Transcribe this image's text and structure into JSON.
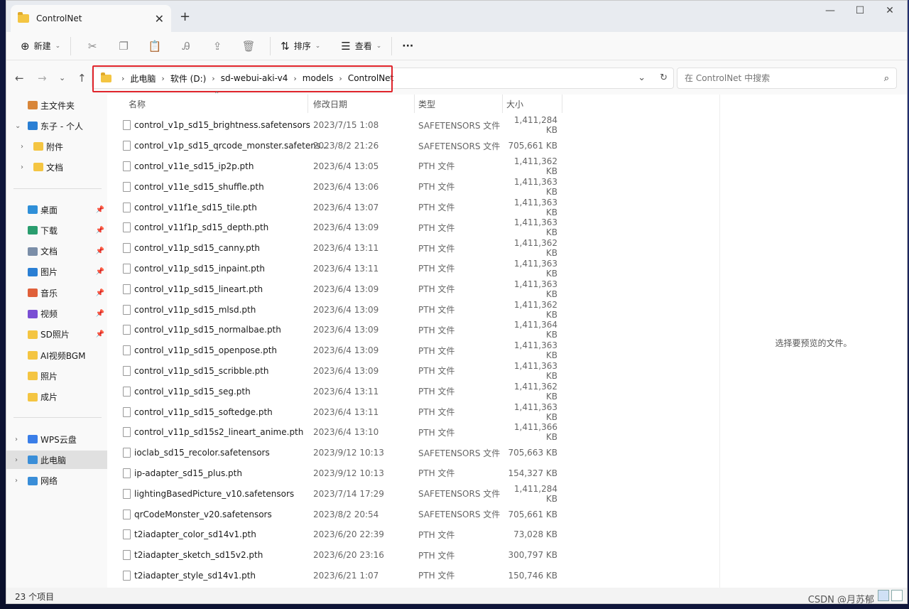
{
  "window": {
    "tab_title": "ControlNet",
    "tab_close": "✕",
    "new_tab": "+",
    "minimize": "—",
    "maximize": "☐",
    "close": "✕"
  },
  "toolbar": {
    "new_label": "新建",
    "sort_label": "排序",
    "view_label": "查看",
    "more_label": "···"
  },
  "address": {
    "breadcrumb": [
      "此电脑",
      "软件 (D:)",
      "sd-webui-aki-v4",
      "models",
      "ControlNet"
    ],
    "search_placeholder": "在 ControlNet 中搜索"
  },
  "sidebar": {
    "quick": [
      {
        "label": "主文件夹",
        "icon": "home-icon"
      },
      {
        "label": "东子 - 个人",
        "icon": "cloud-icon"
      },
      {
        "label": "附件",
        "icon": "folder-icon"
      },
      {
        "label": "文档",
        "icon": "folder-icon"
      }
    ],
    "pinned": [
      {
        "label": "桌面",
        "icon": "desktop-icon",
        "color": "#2f8fd8"
      },
      {
        "label": "下载",
        "icon": "download-icon",
        "color": "#2a9d6e"
      },
      {
        "label": "文档",
        "icon": "document-icon",
        "color": "#7b8ea8"
      },
      {
        "label": "图片",
        "icon": "pictures-icon",
        "color": "#2a7fd4"
      },
      {
        "label": "音乐",
        "icon": "music-icon",
        "color": "#e0603a"
      },
      {
        "label": "视频",
        "icon": "video-icon",
        "color": "#7a4fd4"
      },
      {
        "label": "SD照片",
        "icon": "folder-icon",
        "color": "#f4c542"
      },
      {
        "label": "AI视频BGM",
        "icon": "folder-icon",
        "color": "#f4c542"
      },
      {
        "label": "照片",
        "icon": "folder-icon",
        "color": "#f4c542"
      },
      {
        "label": "成片",
        "icon": "folder-icon",
        "color": "#f4c542"
      }
    ],
    "locations": [
      {
        "label": "WPS云盘",
        "icon": "wps-cloud-icon",
        "color": "#3a7ee8"
      },
      {
        "label": "此电脑",
        "icon": "computer-icon",
        "color": "#3a8ed8"
      },
      {
        "label": "网络",
        "icon": "network-icon",
        "color": "#3a8ed8"
      }
    ]
  },
  "columns": {
    "name": "名称",
    "date": "修改日期",
    "type": "类型",
    "size": "大小"
  },
  "files": [
    {
      "name": "control_v1p_sd15_brightness.safetensors",
      "date": "2023/7/15 1:08",
      "type": "SAFETENSORS 文件",
      "size": "1,411,284 KB"
    },
    {
      "name": "control_v1p_sd15_qrcode_monster.safetens...",
      "date": "2023/8/2 21:26",
      "type": "SAFETENSORS 文件",
      "size": "705,661 KB"
    },
    {
      "name": "control_v11e_sd15_ip2p.pth",
      "date": "2023/6/4 13:05",
      "type": "PTH 文件",
      "size": "1,411,362 KB"
    },
    {
      "name": "control_v11e_sd15_shuffle.pth",
      "date": "2023/6/4 13:06",
      "type": "PTH 文件",
      "size": "1,411,363 KB"
    },
    {
      "name": "control_v11f1e_sd15_tile.pth",
      "date": "2023/6/4 13:07",
      "type": "PTH 文件",
      "size": "1,411,363 KB"
    },
    {
      "name": "control_v11f1p_sd15_depth.pth",
      "date": "2023/6/4 13:09",
      "type": "PTH 文件",
      "size": "1,411,363 KB"
    },
    {
      "name": "control_v11p_sd15_canny.pth",
      "date": "2023/6/4 13:11",
      "type": "PTH 文件",
      "size": "1,411,362 KB"
    },
    {
      "name": "control_v11p_sd15_inpaint.pth",
      "date": "2023/6/4 13:11",
      "type": "PTH 文件",
      "size": "1,411,363 KB"
    },
    {
      "name": "control_v11p_sd15_lineart.pth",
      "date": "2023/6/4 13:09",
      "type": "PTH 文件",
      "size": "1,411,363 KB"
    },
    {
      "name": "control_v11p_sd15_mlsd.pth",
      "date": "2023/6/4 13:09",
      "type": "PTH 文件",
      "size": "1,411,362 KB"
    },
    {
      "name": "control_v11p_sd15_normalbae.pth",
      "date": "2023/6/4 13:09",
      "type": "PTH 文件",
      "size": "1,411,364 KB"
    },
    {
      "name": "control_v11p_sd15_openpose.pth",
      "date": "2023/6/4 13:09",
      "type": "PTH 文件",
      "size": "1,411,363 KB"
    },
    {
      "name": "control_v11p_sd15_scribble.pth",
      "date": "2023/6/4 13:09",
      "type": "PTH 文件",
      "size": "1,411,363 KB"
    },
    {
      "name": "control_v11p_sd15_seg.pth",
      "date": "2023/6/4 13:11",
      "type": "PTH 文件",
      "size": "1,411,362 KB"
    },
    {
      "name": "control_v11p_sd15_softedge.pth",
      "date": "2023/6/4 13:11",
      "type": "PTH 文件",
      "size": "1,411,363 KB"
    },
    {
      "name": "control_v11p_sd15s2_lineart_anime.pth",
      "date": "2023/6/4 13:10",
      "type": "PTH 文件",
      "size": "1,411,366 KB"
    },
    {
      "name": "ioclab_sd15_recolor.safetensors",
      "date": "2023/9/12 10:13",
      "type": "SAFETENSORS 文件",
      "size": "705,663 KB"
    },
    {
      "name": "ip-adapter_sd15_plus.pth",
      "date": "2023/9/12 10:13",
      "type": "PTH 文件",
      "size": "154,327 KB"
    },
    {
      "name": "lightingBasedPicture_v10.safetensors",
      "date": "2023/7/14 17:29",
      "type": "SAFETENSORS 文件",
      "size": "1,411,284 KB"
    },
    {
      "name": "qrCodeMonster_v20.safetensors",
      "date": "2023/8/2 20:54",
      "type": "SAFETENSORS 文件",
      "size": "705,661 KB"
    },
    {
      "name": "t2iadapter_color_sd14v1.pth",
      "date": "2023/6/20 22:39",
      "type": "PTH 文件",
      "size": "73,028 KB"
    },
    {
      "name": "t2iadapter_sketch_sd15v2.pth",
      "date": "2023/6/20 23:16",
      "type": "PTH 文件",
      "size": "300,797 KB"
    },
    {
      "name": "t2iadapter_style_sd14v1.pth",
      "date": "2023/6/21 1:07",
      "type": "PTH 文件",
      "size": "150,746 KB"
    }
  ],
  "preview": {
    "text": "选择要预览的文件。"
  },
  "status": {
    "count": "23 个项目"
  },
  "watermark": "CSDN @月苏郁",
  "colors": {
    "highlight": "#e0242b",
    "selected": "#e0e0e0"
  }
}
